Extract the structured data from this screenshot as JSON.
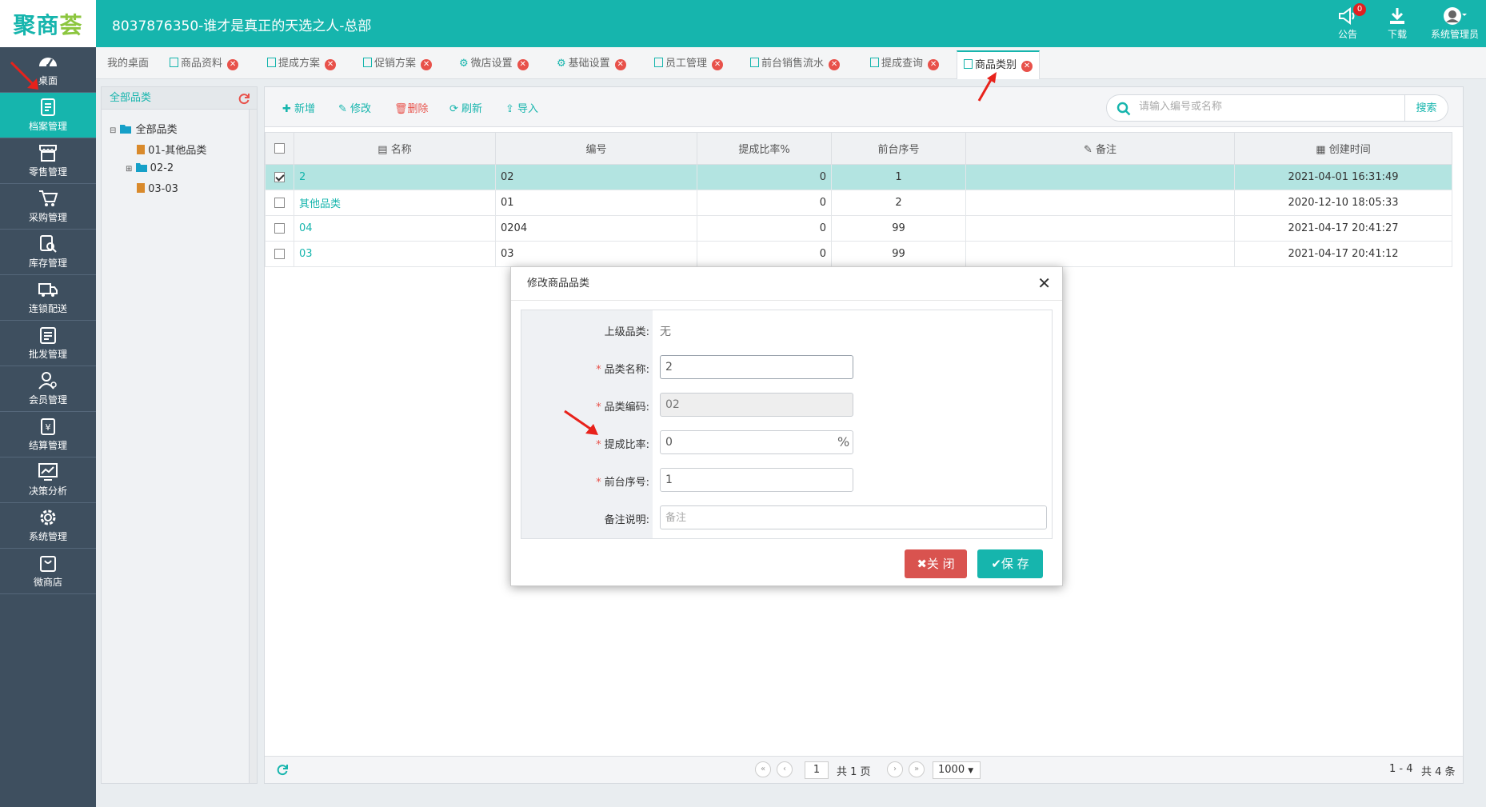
{
  "header": {
    "logo_part1": "聚商",
    "logo_part2": "荟",
    "title": "8037876350-谁才是真正的天选之人-总部",
    "notice_label": "公告",
    "notice_count": "0",
    "download_label": "下载",
    "user_label": "系统管理员"
  },
  "sidebar": {
    "items": [
      {
        "label": "桌面",
        "icon": "dashboard-icon"
      },
      {
        "label": "档案管理",
        "icon": "archive-icon"
      },
      {
        "label": "零售管理",
        "icon": "store-icon"
      },
      {
        "label": "采购管理",
        "icon": "cart-icon"
      },
      {
        "label": "库存管理",
        "icon": "inventory-icon"
      },
      {
        "label": "连锁配送",
        "icon": "truck-icon"
      },
      {
        "label": "批发管理",
        "icon": "wholesale-icon"
      },
      {
        "label": "会员管理",
        "icon": "member-icon"
      },
      {
        "label": "结算管理",
        "icon": "settlement-icon"
      },
      {
        "label": "决策分析",
        "icon": "chart-icon"
      },
      {
        "label": "系统管理",
        "icon": "gear-icon"
      },
      {
        "label": "微商店",
        "icon": "bag-icon"
      }
    ]
  },
  "tabs": [
    {
      "label": "我的桌面"
    },
    {
      "label": "商品资料"
    },
    {
      "label": "提成方案"
    },
    {
      "label": "促销方案"
    },
    {
      "label": "微店设置"
    },
    {
      "label": "基础设置"
    },
    {
      "label": "员工管理"
    },
    {
      "label": "前台销售流水"
    },
    {
      "label": "提成查询"
    },
    {
      "label": "商品类别"
    }
  ],
  "tree": {
    "title": "全部品类",
    "nodes": [
      {
        "label": "全部品类"
      },
      {
        "label": "01-其他品类"
      },
      {
        "label": "02-2"
      },
      {
        "label": "03-03"
      }
    ]
  },
  "toolbar": {
    "add": "新增",
    "edit": "修改",
    "delete": "删除",
    "refresh": "刷新",
    "import": "导入",
    "search_placeholder": "请输入编号或名称",
    "search_btn": "搜索"
  },
  "grid": {
    "columns": [
      "名称",
      "编号",
      "提成比率%",
      "前台序号",
      "备注",
      "创建时间"
    ],
    "rows": [
      {
        "name": "2",
        "code": "02",
        "rate": "0",
        "seq": "1",
        "note": "",
        "time": "2021-04-01 16:31:49"
      },
      {
        "name": "其他品类",
        "code": "01",
        "rate": "0",
        "seq": "2",
        "note": "",
        "time": "2020-12-10 18:05:33"
      },
      {
        "name": "04",
        "code": "0204",
        "rate": "0",
        "seq": "99",
        "note": "",
        "time": "2021-04-17 20:41:27"
      },
      {
        "name": "03",
        "code": "03",
        "rate": "0",
        "seq": "99",
        "note": "",
        "time": "2021-04-17 20:41:12"
      }
    ]
  },
  "pager": {
    "page": "1",
    "total_pages": "共 1 页",
    "page_size": "1000",
    "range": "1 - 4",
    "total": "共 4 条"
  },
  "modal": {
    "title": "修改商品品类",
    "parent_label": "上级品类:",
    "parent_value": "无",
    "name_label": "品类名称:",
    "name_value": "2",
    "code_label": "品类编码:",
    "code_value": "02",
    "rate_label": "提成比率:",
    "rate_value": "0",
    "rate_unit": "%",
    "seq_label": "前台序号:",
    "seq_value": "1",
    "note_label": "备注说明:",
    "note_placeholder": "备注",
    "close_btn": "关 闭",
    "save_btn": "保 存"
  },
  "colors": {
    "brand": "#16b5ad",
    "sidebar": "#3e4f5f",
    "danger": "#d9534f"
  }
}
